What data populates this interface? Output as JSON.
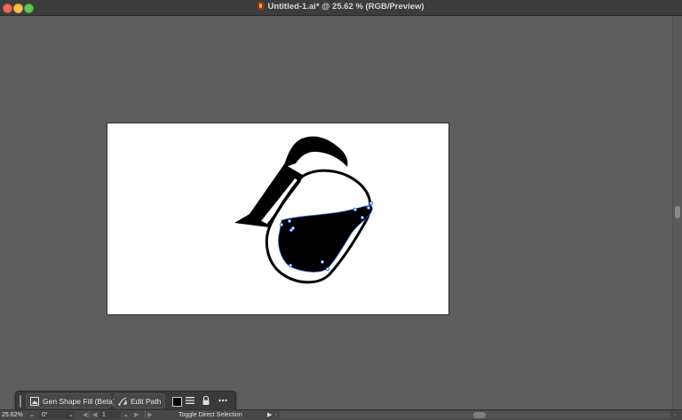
{
  "window": {
    "title": "Untitled-1.ai* @ 25.62 % (RGB/Preview)",
    "doc_icon": "illustrator-doc-icon"
  },
  "context_bar": {
    "gen_shape_fill": "Gen Shape Fill (Beta)",
    "edit_path": "Edit Path",
    "fill_color": "#000000"
  },
  "status_bar": {
    "zoom": "25.62%",
    "rotation": "0°",
    "artboard_number": "1",
    "tool_hint": "Toggle Direct Selection"
  },
  "colors": {
    "canvas_bg": "#5e5e5e",
    "artboard_bg": "#ffffff",
    "selection": "#3a6bd8"
  }
}
